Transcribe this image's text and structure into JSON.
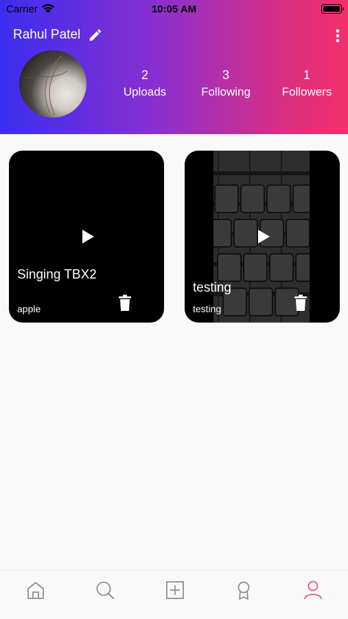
{
  "status_bar": {
    "carrier": "Carrier",
    "time": "10:05 AM"
  },
  "profile": {
    "name": "Rahul Patel",
    "stats": [
      {
        "value": "2",
        "label": "Uploads"
      },
      {
        "value": "3",
        "label": "Following"
      },
      {
        "value": "1",
        "label": "Followers"
      }
    ]
  },
  "videos": [
    {
      "title": "Singing TBX2",
      "subtitle": "apple"
    },
    {
      "title": "testing",
      "subtitle": "testing"
    }
  ],
  "tabbar": {
    "items": [
      "home-icon",
      "search-icon",
      "add-icon",
      "award-icon",
      "profile-icon"
    ],
    "active_color": "#f0508a",
    "inactive_color": "#8e8e93"
  },
  "colors": {
    "gradient_start": "#3b2ef0",
    "gradient_end": "#f42f6a"
  }
}
